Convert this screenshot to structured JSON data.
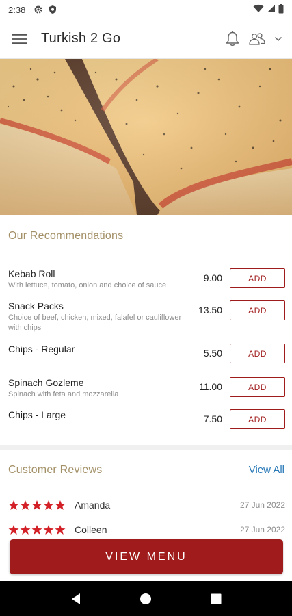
{
  "status_bar": {
    "time": "2:38",
    "icons": [
      "gear-icon",
      "shield-icon",
      "wifi-icon",
      "signal-icon",
      "battery-icon"
    ]
  },
  "app_bar": {
    "title": "Turkish 2 Go",
    "icons": [
      "hamburger-menu-icon",
      "bell-icon",
      "users-icon",
      "chevron-down-icon"
    ]
  },
  "colors": {
    "brand": "#a01c1c",
    "section_title": "#a39067",
    "link": "#2a7ab8",
    "star": "#d32027"
  },
  "recommendations": {
    "title": "Our Recommendations",
    "add_label": "ADD",
    "items": [
      {
        "name": "Kebab Roll",
        "description": "With lettuce, tomato, onion and choice of sauce",
        "price": "9.00"
      },
      {
        "name": "Snack Packs",
        "description": "Choice of beef, chicken, mixed, falafel or cauliflower with chips",
        "price": "13.50"
      },
      {
        "name": "Chips - Regular",
        "description": "",
        "price": "5.50"
      },
      {
        "name": "Spinach Gozleme",
        "description": "Spinach with feta and mozzarella",
        "price": "11.00"
      },
      {
        "name": "Chips - Large",
        "description": "",
        "price": "7.50"
      }
    ]
  },
  "reviews": {
    "title": "Customer Reviews",
    "view_all": "View All",
    "items": [
      {
        "name": "Amanda",
        "date": "27 Jun 2022",
        "rating": 5
      },
      {
        "name": "Colleen",
        "date": "27 Jun 2022",
        "rating": 5
      }
    ]
  },
  "view_menu_label": "VIEW MENU",
  "nav_bar": {
    "icons": [
      "back-icon",
      "home-icon",
      "recents-icon"
    ]
  }
}
